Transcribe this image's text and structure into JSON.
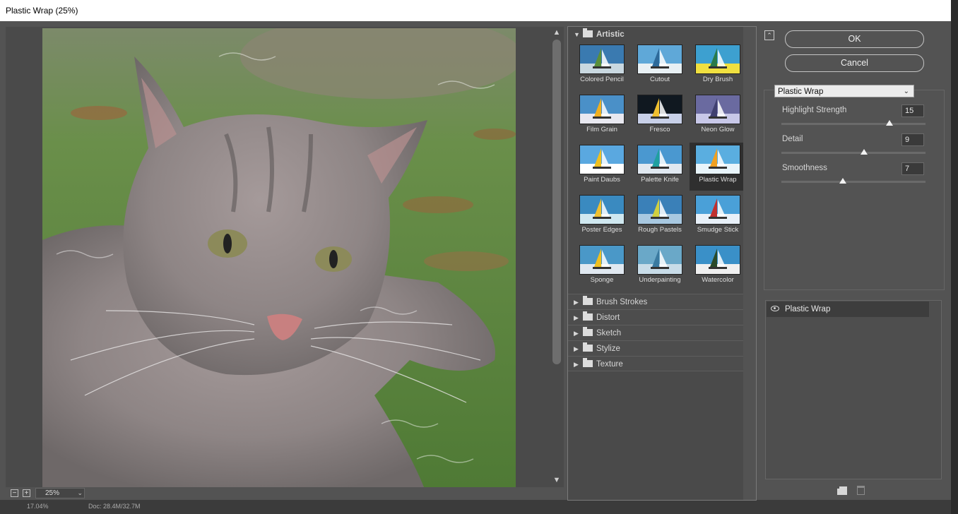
{
  "window": {
    "title": "Plastic Wrap (25%)"
  },
  "preview": {
    "zoom": "25%"
  },
  "status": {
    "left": "17.04%",
    "doc": "Doc: 28.4M/32.7M"
  },
  "gallery": {
    "open_category": "Artistic",
    "thumbnails": [
      {
        "label": "Colored Pencil"
      },
      {
        "label": "Cutout"
      },
      {
        "label": "Dry Brush"
      },
      {
        "label": "Film Grain"
      },
      {
        "label": "Fresco"
      },
      {
        "label": "Neon Glow"
      },
      {
        "label": "Paint Daubs"
      },
      {
        "label": "Palette Knife"
      },
      {
        "label": "Plastic Wrap"
      },
      {
        "label": "Poster Edges"
      },
      {
        "label": "Rough Pastels"
      },
      {
        "label": "Smudge Stick"
      },
      {
        "label": "Sponge"
      },
      {
        "label": "Underpainting"
      },
      {
        "label": "Watercolor"
      }
    ],
    "selected": "Plastic Wrap",
    "categories": [
      "Brush Strokes",
      "Distort",
      "Sketch",
      "Stylize",
      "Texture"
    ]
  },
  "buttons": {
    "ok": "OK",
    "cancel": "Cancel"
  },
  "settings": {
    "filter": "Plastic Wrap",
    "params": [
      {
        "label": "Highlight Strength",
        "value": "15",
        "min": 0,
        "max": 20
      },
      {
        "label": "Detail",
        "value": "9",
        "min": 1,
        "max": 15
      },
      {
        "label": "Smoothness",
        "value": "7",
        "min": 1,
        "max": 15
      }
    ]
  },
  "layers": {
    "items": [
      {
        "label": "Plastic Wrap",
        "visible": true
      }
    ]
  },
  "icons": {
    "eye": "eye-icon",
    "new_layer": "new-layer-icon",
    "trash": "trash-icon",
    "collapse": "collapse-icon",
    "folder": "folder-icon"
  }
}
